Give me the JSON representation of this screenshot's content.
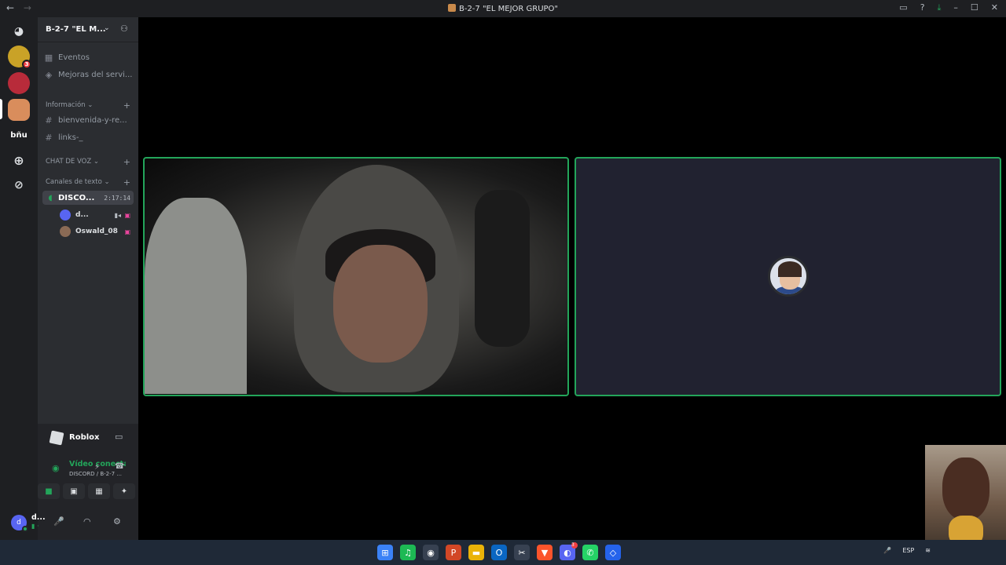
{
  "titlebar": {
    "back": "←",
    "forward": "→",
    "title": "B-2-7 \"EL MEJOR GRUPO\"",
    "icons": [
      "inbox-icon",
      "help-icon",
      "download-icon"
    ],
    "minimize": "–",
    "maximize": "☐",
    "close": "✕"
  },
  "guilds": {
    "home_icon": "discord-icon",
    "items": [
      {
        "label": "",
        "color": "#c9a227",
        "badge": "3"
      },
      {
        "label": "",
        "color": "#b82b3a"
      },
      {
        "label": "",
        "color": "#d98d5c"
      },
      {
        "label": "bñu",
        "color": "#1e1f22"
      }
    ],
    "add_icon": "+",
    "explore_icon": "⊘"
  },
  "server": {
    "name": "B-2-7 \"EL M...",
    "chevron": "⌄",
    "invite_icon": "add-person-icon"
  },
  "channels": {
    "top": [
      {
        "icon": "▦",
        "label": "Eventos"
      },
      {
        "icon": "◈",
        "label": "Mejoras del servi..."
      }
    ],
    "category_info": {
      "label": "Información ⌄",
      "plus": "+"
    },
    "text_channels": [
      {
        "icon": "#",
        "label": "bienvenida-y-re..."
      },
      {
        "icon": "#",
        "label": "links-_"
      }
    ],
    "category_voice": {
      "label": "CHAT DE VOZ ⌄",
      "plus": "+"
    },
    "category_text": {
      "label": "Canales de texto ⌄",
      "plus": "+"
    },
    "voice_channel": {
      "icon": "🔊",
      "label": "DISCO...",
      "time": "2:17:14"
    },
    "members": [
      {
        "name": "d...",
        "avatar_color": "#5865f2",
        "cam": "▮◂",
        "live": "▣"
      },
      {
        "name": "Oswald_08",
        "avatar_color": "#8a6a55",
        "live": "▣"
      }
    ]
  },
  "activity": {
    "game": "Roblox",
    "game_icon": "roblox-icon",
    "action_icon": "▭"
  },
  "voice_status": {
    "status": "Vídeo conectac",
    "sub": "DISCORD / B-2-7 ...",
    "noise_icon": "⚡",
    "disconnect_icon": "☎",
    "buttons": [
      "■",
      "▣",
      "▦",
      "✦"
    ]
  },
  "user": {
    "initial": "d",
    "name": "d...",
    "status": "▮ · ",
    "mic_icon": "🎤",
    "headset_icon": "◠",
    "settings_icon": "⚙"
  },
  "taskbar": {
    "apps": [
      {
        "name": "windows-start-icon",
        "glyph": "⊞",
        "color": "#3b82f6"
      },
      {
        "name": "spotify-icon",
        "glyph": "♫",
        "color": "#1db954"
      },
      {
        "name": "obs-icon",
        "glyph": "◉",
        "color": "#374151"
      },
      {
        "name": "powerpoint-icon",
        "glyph": "P",
        "color": "#d24726"
      },
      {
        "name": "file-explorer-icon",
        "glyph": "▬",
        "color": "#eab308"
      },
      {
        "name": "outlook-icon",
        "glyph": "O",
        "color": "#0a66c2"
      },
      {
        "name": "capcut-icon",
        "glyph": "✂",
        "color": "#374151"
      },
      {
        "name": "brave-icon",
        "glyph": "▼",
        "color": "#fb542b"
      },
      {
        "name": "discord-taskbar-icon",
        "glyph": "◐",
        "color": "#5865f2",
        "badge": "3"
      },
      {
        "name": "whatsapp-icon",
        "glyph": "✆",
        "color": "#25d366"
      },
      {
        "name": "roblox-taskbar-icon",
        "glyph": "◇",
        "color": "#2563eb"
      }
    ],
    "tray": {
      "mic": "🎤",
      "lang": "ESP",
      "wifi": "≋"
    }
  }
}
